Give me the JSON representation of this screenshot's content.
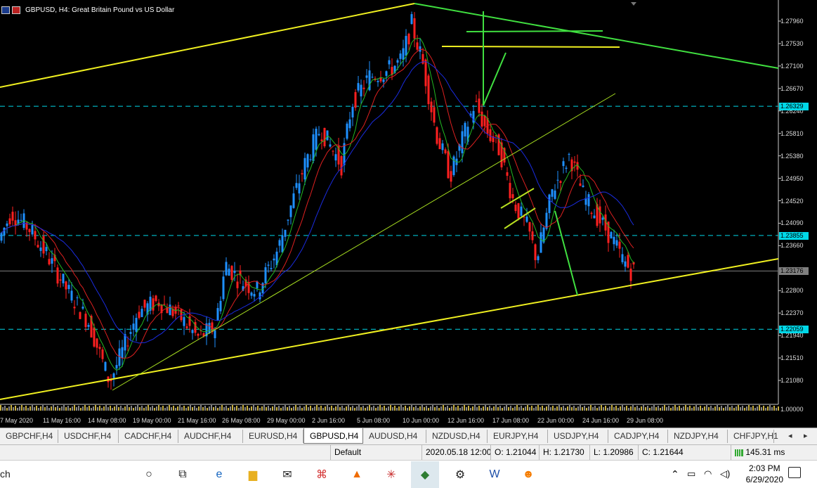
{
  "window": {
    "title": "GBPUSD, H4:  Great Britain Pound vs US Dollar"
  },
  "price_axis": {
    "labels": [
      "1.27960",
      "1.27530",
      "1.27100",
      "1.26670",
      "1.26240",
      "1.25810",
      "1.25380",
      "1.24950",
      "1.24520",
      "1.24090",
      "1.23660",
      "1.22800",
      "1.22370",
      "1.21940",
      "1.21510",
      "1.21080"
    ],
    "markers": [
      {
        "value": "1.26329",
        "color": "#00d8e8"
      },
      {
        "value": "1.23855",
        "color": "#00d8e8"
      },
      {
        "value": "1.23176",
        "color": "#7f7f7f"
      },
      {
        "value": "1.22059",
        "color": "#00d8e8"
      }
    ],
    "bottom_label": "1.00000"
  },
  "date_axis": {
    "labels": [
      "7 May 2020",
      "11 May 16:00",
      "14 May 08:00",
      "19 May 00:00",
      "21 May 16:00",
      "26 May 08:00",
      "29 May 00:00",
      "2 Jun 16:00",
      "5 Jun 08:00",
      "10 Jun 00:00",
      "12 Jun 16:00",
      "17 Jun 08:00",
      "22 Jun 00:00",
      "24 Jun 16:00",
      "29 Jun 08:00"
    ]
  },
  "tabs": {
    "items": [
      "GBPCHF,H4",
      "USDCHF,H4",
      "CADCHF,H4",
      "AUDCHF,H4",
      "EURUSD,H4",
      "GBPUSD,H4",
      "AUDUSD,H4",
      "NZDUSD,H4",
      "EURJPY,H4",
      "USDJPY,H4",
      "CADJPY,H4",
      "NZDJPY,H4",
      "CHFJPY,H1"
    ],
    "active": "GBPUSD,H4",
    "scroll_left": "◂",
    "scroll_right": "▸"
  },
  "status": {
    "profile": "Default",
    "datetime": "2020.05.18 12:00",
    "open": "O: 1.21044",
    "high": "H: 1.21730",
    "low": "L: 1.20986",
    "close": "C: 1.21644",
    "ping": "145.31 ms"
  },
  "taskbar": {
    "search_partial": "ch",
    "icons": [
      "cortana-circle-icon",
      "task-view-icon",
      "edge-icon",
      "file-explorer-icon",
      "mail-icon",
      "acrobat-icon",
      "vlc-icon",
      "spider-icon",
      "metatrader-icon",
      "settings-gear-icon",
      "word-icon",
      "ucbrowser-icon"
    ],
    "time": "2:03 PM",
    "date": "6/29/2020"
  },
  "colors": {
    "chart_bg": "#000000",
    "bull": "#1e90ff",
    "bear": "#ff2020",
    "ma_fast": "#22b822",
    "ma_mid": "#dd2020",
    "ma_slow": "#1a2ce0",
    "trend_yellow": "#f0f020",
    "trend_green": "#40e040",
    "level_cyan": "#00d8e8"
  }
}
